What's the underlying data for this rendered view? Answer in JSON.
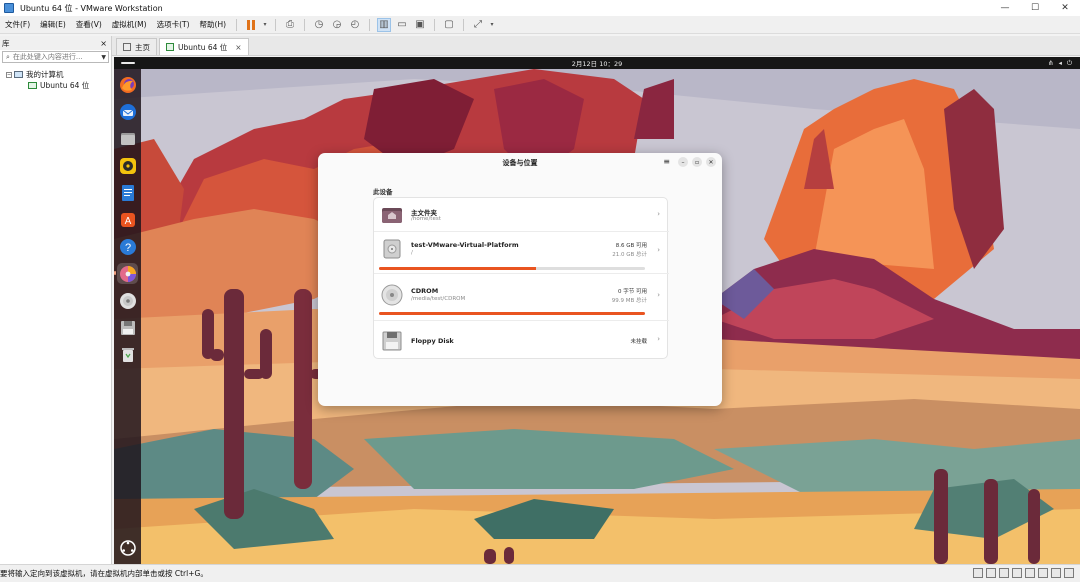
{
  "window": {
    "title": "Ubuntu 64 位 - VMware Workstation",
    "minimize": "—",
    "maximize": "☐",
    "close": "✕"
  },
  "menu": {
    "items": [
      "文件(F)",
      "编辑(E)",
      "查看(V)",
      "虚拟机(M)",
      "选项卡(T)",
      "帮助(H)"
    ]
  },
  "library": {
    "header": "库",
    "close": "×",
    "search_placeholder": "在此处键入内容进行...",
    "tree": {
      "root": "我的计算机",
      "vm": "Ubuntu 64 位"
    }
  },
  "tabs": [
    {
      "label": "主页"
    },
    {
      "label": "Ubuntu 64 位",
      "close": "×"
    }
  ],
  "guest": {
    "clock": "2月12日 10：29",
    "dialog": {
      "title": "设备与位置",
      "section": "此设备",
      "devices": [
        {
          "name": "主文件夹",
          "path": "/home/test",
          "free": "",
          "total": "",
          "usage": null
        },
        {
          "name": "test-VMware-Virtual-Platform",
          "path": "/",
          "free": "8.6 GB 可用",
          "total": "21.0 GB 总计",
          "usage": 0.59
        },
        {
          "name": "CDROM",
          "path": "/media/test/CDROM",
          "free": "0 字节 可用",
          "total": "99.9 MB 总计",
          "usage": 1.0
        },
        {
          "name": "Floppy Disk",
          "path": "",
          "free": "未挂载",
          "total": "",
          "usage": null
        }
      ]
    }
  },
  "statusbar": {
    "text": "要将输入定向到该虚拟机，请在虚拟机内部单击或按 Ctrl+G。"
  },
  "colors": {
    "accent": "#e95420",
    "dock": "#1e141c"
  }
}
